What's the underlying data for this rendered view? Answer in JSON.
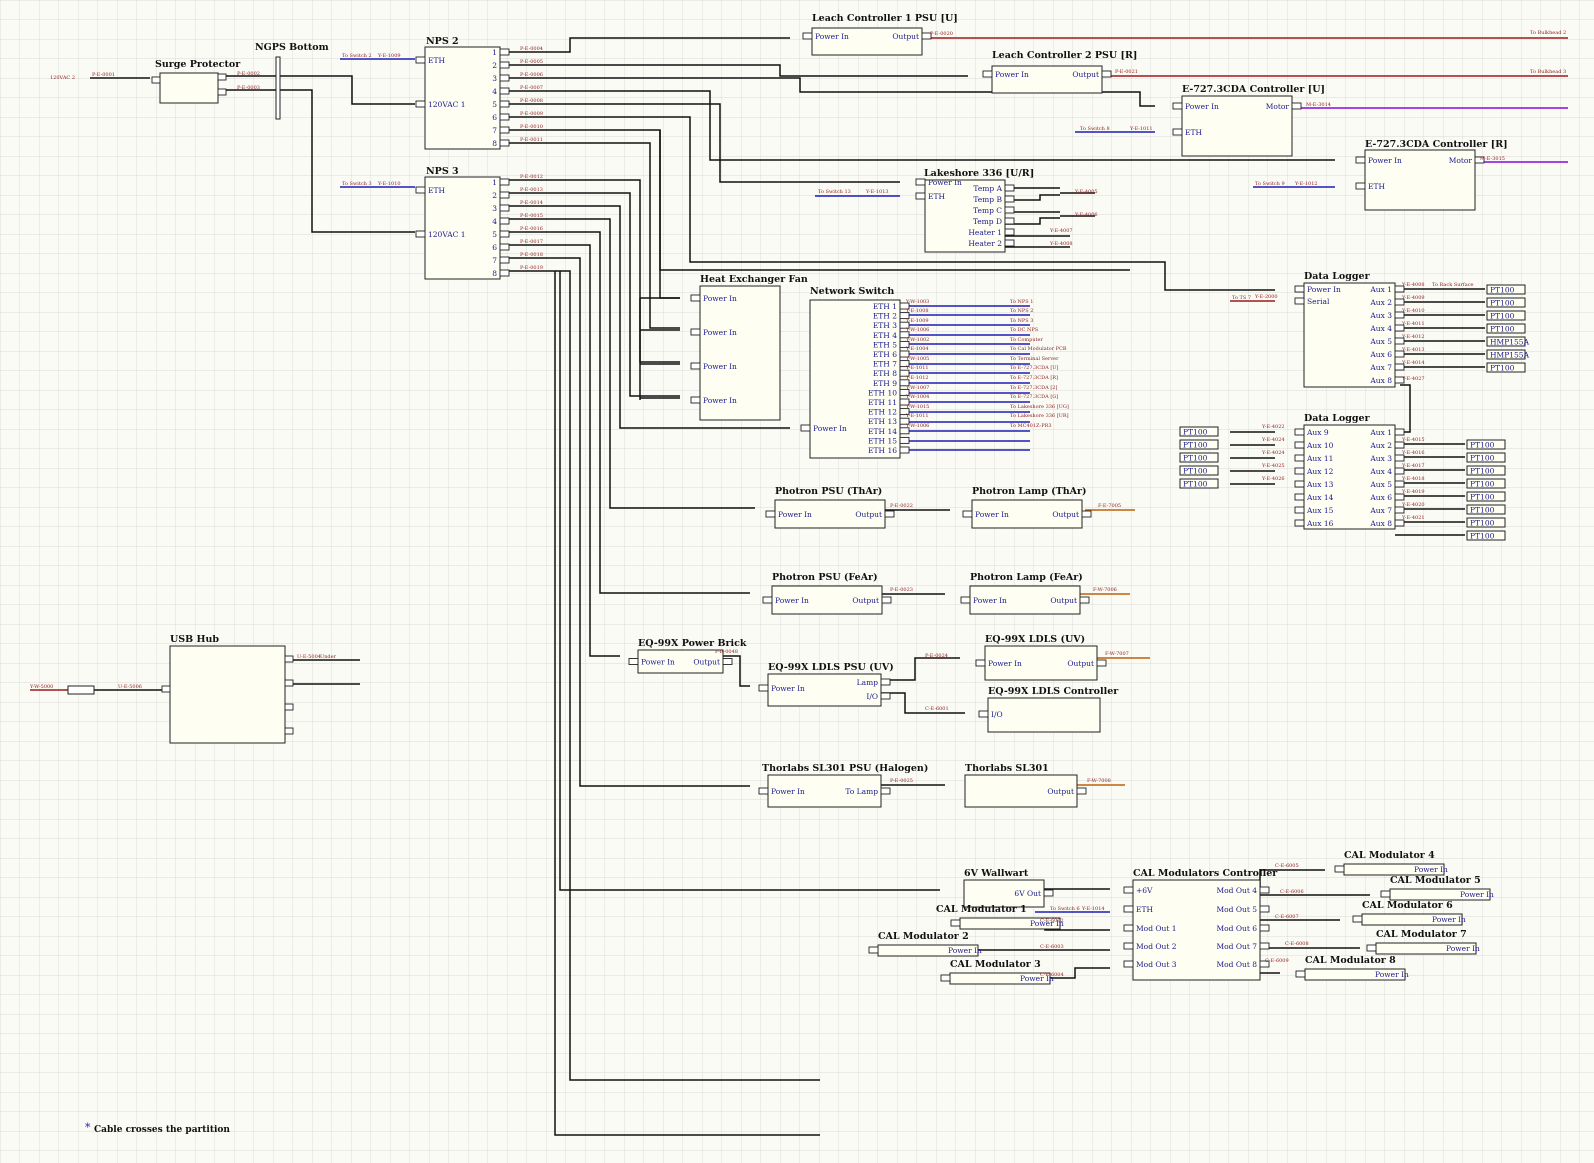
{
  "diagram": {
    "title": "",
    "colors": {
      "grid": "#c8c8c8",
      "power": "#111111",
      "ethernet": "#1c1cb8",
      "serial": "#9b1b1b",
      "motor": "#9a2be0",
      "fiber": "#c0600a",
      "box_fill": "#fefef3"
    },
    "footnote": {
      "star": "*",
      "text": "Cable crosses the partition"
    },
    "components": [
      {
        "id": "surge",
        "title": "Surge Protector",
        "ports": []
      },
      {
        "id": "ngps",
        "title": "NGPS Bottom",
        "ports": []
      },
      {
        "id": "nps2",
        "title": "NPS 2",
        "ports": [
          "ETH",
          "120VAC 1",
          "1",
          "2",
          "3",
          "4",
          "5",
          "6",
          "7",
          "8"
        ]
      },
      {
        "id": "nps3",
        "title": "NPS 3",
        "ports": [
          "ETH",
          "120VAC 1",
          "1",
          "2",
          "3",
          "4",
          "5",
          "6",
          "7",
          "8"
        ]
      },
      {
        "id": "leach1",
        "title": "Leach Controller 1 PSU [U]",
        "ports": [
          "Power In",
          "Output"
        ]
      },
      {
        "id": "leach2",
        "title": "Leach Controller 2 PSU [R]",
        "ports": [
          "Power In",
          "Output"
        ]
      },
      {
        "id": "e727u",
        "title": "E-727.3CDA Controller [U]",
        "ports": [
          "Power In",
          "ETH",
          "Motor"
        ]
      },
      {
        "id": "e727r",
        "title": "E-727.3CDA Controller [R]",
        "ports": [
          "Power In",
          "ETH",
          "Motor"
        ]
      },
      {
        "id": "lakeshore",
        "title": "Lakeshore 336 [U/R]",
        "ports": [
          "Power In",
          "ETH",
          "Temp A",
          "Temp B",
          "Temp C",
          "Temp D",
          "Heater 1",
          "Heater 2"
        ]
      },
      {
        "id": "hefan",
        "title": "Heat Exchanger Fan",
        "ports": [
          "Power In",
          "Power In",
          "Power In",
          "Power In"
        ]
      },
      {
        "id": "netswitch",
        "title": "Network Switch",
        "ports": [
          "ETH 1",
          "ETH 2",
          "ETH 3",
          "ETH 4",
          "ETH 5",
          "ETH 6",
          "ETH 7",
          "ETH 8",
          "ETH 9",
          "ETH 10",
          "ETH 11",
          "ETH 12",
          "ETH 13",
          "ETH 14",
          "ETH 15",
          "ETH 16",
          "Power In"
        ]
      },
      {
        "id": "dl1",
        "title": "Data Logger",
        "ports": [
          "Power In",
          "Serial",
          "Aux 1",
          "Aux 2",
          "Aux 3",
          "Aux 4",
          "Aux 5",
          "Aux 6",
          "Aux 7",
          "Aux 8"
        ]
      },
      {
        "id": "dl2",
        "title": "Data Logger",
        "ports": [
          "Aux 9",
          "Aux 10",
          "Aux 11",
          "Aux 12",
          "Aux 13",
          "Aux 14",
          "Aux 15",
          "Aux 16",
          "Aux 1",
          "Aux 2",
          "Aux 3",
          "Aux 4",
          "Aux 5",
          "Aux 6",
          "Aux 7",
          "Aux 8"
        ]
      },
      {
        "id": "ppsuthar",
        "title": "Photron PSU (ThAr)",
        "ports": [
          "Power In",
          "Output"
        ]
      },
      {
        "id": "plampthar",
        "title": "Photron Lamp (ThAr)",
        "ports": [
          "Power In",
          "Output"
        ]
      },
      {
        "id": "ppsufear",
        "title": "Photron PSU (FeAr)",
        "ports": [
          "Power In",
          "Output"
        ]
      },
      {
        "id": "plampfear",
        "title": "Photron Lamp (FeAr)",
        "ports": [
          "Power In",
          "Output"
        ]
      },
      {
        "id": "usbhub",
        "title": "USB Hub",
        "ports": []
      },
      {
        "id": "eqbrick",
        "title": "EQ-99X Power Brick",
        "ports": [
          "Power In",
          "Output"
        ]
      },
      {
        "id": "eqldlspsu",
        "title": "EQ-99X LDLS PSU (UV)",
        "ports": [
          "Power In",
          "Lamp",
          "I/O"
        ]
      },
      {
        "id": "eqldls",
        "title": "EQ-99X LDLS (UV)",
        "ports": [
          "Power In",
          "Output"
        ]
      },
      {
        "id": "eqctrl",
        "title": "EQ-99X LDLS Controller",
        "ports": [
          "I/O"
        ]
      },
      {
        "id": "slpsu",
        "title": "Thorlabs SL301 PSU (Halogen)",
        "ports": [
          "Power In",
          "To Lamp"
        ]
      },
      {
        "id": "sl301",
        "title": "Thorlabs SL301",
        "ports": [
          "Output"
        ]
      },
      {
        "id": "wallwart",
        "title": "6V Wallwart",
        "ports": [
          "6V Out"
        ]
      },
      {
        "id": "calctrl",
        "title": "CAL Modulators Controller",
        "ports": [
          "+6V",
          "ETH",
          "Mod Out 1",
          "Mod Out 2",
          "Mod Out 3",
          "Mod Out 4",
          "Mod Out 5",
          "Mod Out 6",
          "Mod Out 7",
          "Mod Out 8"
        ]
      },
      {
        "id": "cal1",
        "title": "CAL Modulator 1",
        "ports": [
          "Power In"
        ]
      },
      {
        "id": "cal2",
        "title": "CAL Modulator 2",
        "ports": [
          "Power In"
        ]
      },
      {
        "id": "cal3",
        "title": "CAL Modulator 3",
        "ports": [
          "Power In"
        ]
      },
      {
        "id": "cal4",
        "title": "CAL Modulator 4",
        "ports": [
          "Power In"
        ]
      },
      {
        "id": "cal5",
        "title": "CAL Modulator 5",
        "ports": [
          "Power In"
        ]
      },
      {
        "id": "cal6",
        "title": "CAL Modulator 6",
        "ports": [
          "Power In"
        ]
      },
      {
        "id": "cal7",
        "title": "CAL Modulator 7",
        "ports": [
          "Power In"
        ]
      },
      {
        "id": "cal8",
        "title": "CAL Modulator 8",
        "ports": [
          "Power In"
        ]
      }
    ],
    "sensors": {
      "dl1": [
        "PT100",
        "PT100",
        "PT100",
        "PT100",
        "HMP155A",
        "HMP155A",
        "PT100"
      ],
      "dl2_left": [
        "PT100",
        "PT100",
        "PT100",
        "PT100",
        "PT100"
      ],
      "dl2_right": [
        "PT100",
        "PT100",
        "PT100",
        "PT100",
        "PT100",
        "PT100",
        "PT100",
        "PT100"
      ]
    },
    "labels": [
      "120VAC 2",
      "P-E-0001",
      "P-E-0002",
      "P-E-0003",
      "To Switch 2",
      "Y-E-1009",
      "To Switch 3",
      "Y-E-1010",
      "P-E-0004",
      "P-E-0005",
      "P-E-0006",
      "P-E-0007",
      "P-E-0008",
      "P-E-0009",
      "P-E-0010",
      "P-E-0011",
      "P-E-0012",
      "P-E-0013",
      "P-E-0014",
      "P-E-0015",
      "P-E-0016",
      "P-E-0017",
      "P-E-0018",
      "P-E-0019",
      "P-E-0020",
      "To Bulkhead 2",
      "P-E-0021",
      "To Bulkhead 3",
      "M-E-3014",
      "M-E-3015",
      "To Switch 8",
      "Y-E-1011",
      "To Switch 9",
      "Y-E-1012",
      "To Switch 13",
      "Y-E-1013",
      "Y-E-4005",
      "Y-E-4006",
      "Y-E-4007",
      "Y-E-4008",
      "Y-W-1003",
      "Y-E-1008",
      "Y-E-1009",
      "Y-W-1006",
      "Y-W-1002",
      "Y-E-1004",
      "Y-W-1005",
      "Y-E-1011",
      "Y-E-1012",
      "Y-W-1007",
      "Y-W-1004",
      "Y-W-1015",
      "Y-E-1011",
      "Y-W-1006",
      "To NPS 1",
      "To NPS 2",
      "To NPS 3",
      "To DC NPS",
      "To Computer",
      "To Cal Modulator PCB",
      "To Terminal Server",
      "To E-727.3CDA [U]",
      "To E-727.3CDA [R]",
      "To E-727.3CDA [2]",
      "To E-727.3CDA [G]",
      "To Lakeshore 336 [UG]",
      "To Lakeshore 336 [UR]",
      "To MC401Z-PR3",
      "To TS 7",
      "Y-E-2000",
      "Y-E-4008",
      "To Rack Surface",
      "Y-E-4009",
      "Y-E-4010",
      "Y-E-4011",
      "Y-E-4012",
      "Y-E-4013",
      "Y-E-4014",
      "Y-E-4027",
      "Y-E-4022",
      "Y-E-4024",
      "Y-E-4024",
      "Y-E-4025",
      "Y-E-4026",
      "Y-E-4015",
      "Y-E-4016",
      "Y-E-4017",
      "Y-E-4018",
      "Y-E-4019",
      "Y-E-4020",
      "Y-E-4021",
      "P-E-0022",
      "F-E-7005",
      "P-E-0023",
      "F-W-7006",
      "P-E-0048",
      "P-E-0024",
      "F-W-7007",
      "C-E-6001",
      "P-E-0025",
      "F-W-7008",
      "Y-W-5000",
      "U-E-5006",
      "U-E-5004",
      "Under",
      "To Switch 6",
      "Y-E-1014",
      "C-E-6005",
      "C-E-6006",
      "C-E-6007",
      "C-E-6008",
      "C-E-6009",
      "C-E-6002",
      "C-E-6003",
      "C-E-6004"
    ]
  }
}
